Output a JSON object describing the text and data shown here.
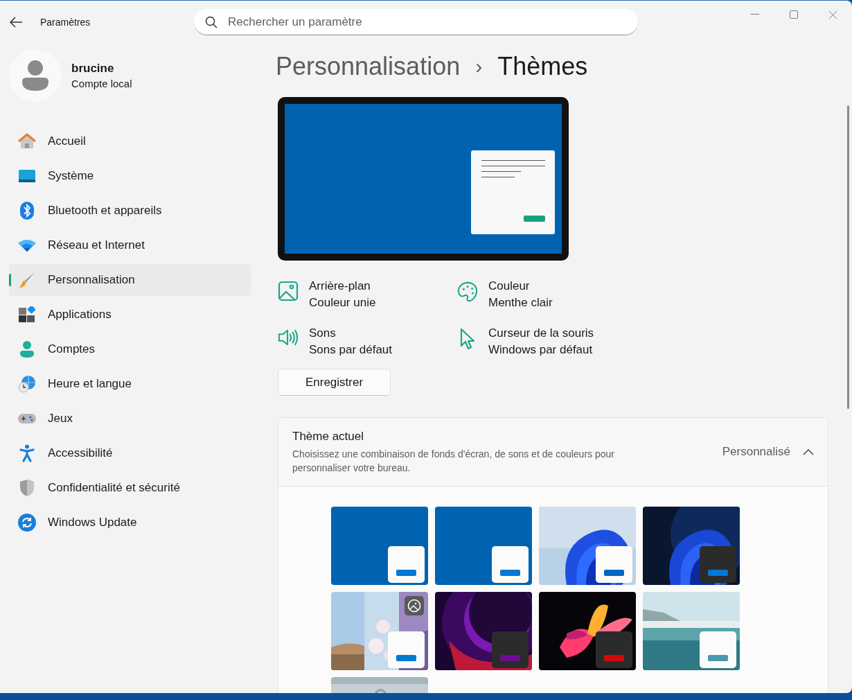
{
  "window": {
    "title": "Paramètres"
  },
  "search": {
    "placeholder": "Rechercher un paramètre"
  },
  "account": {
    "name": "brucine",
    "type": "Compte local"
  },
  "sidebar": {
    "items": [
      {
        "label": "Accueil",
        "selected": false
      },
      {
        "label": "Système",
        "selected": false
      },
      {
        "label": "Bluetooth et appareils",
        "selected": false
      },
      {
        "label": "Réseau et Internet",
        "selected": false
      },
      {
        "label": "Personnalisation",
        "selected": true
      },
      {
        "label": "Applications",
        "selected": false
      },
      {
        "label": "Comptes",
        "selected": false
      },
      {
        "label": "Heure et langue",
        "selected": false
      },
      {
        "label": "Jeux",
        "selected": false
      },
      {
        "label": "Accessibilité",
        "selected": false
      },
      {
        "label": "Confidentialité et sécurité",
        "selected": false
      },
      {
        "label": "Windows Update",
        "selected": false
      }
    ]
  },
  "breadcrumb": {
    "parent": "Personnalisation",
    "separator": "›",
    "current": "Thèmes"
  },
  "settings": [
    {
      "title": "Arrière-plan",
      "value": "Couleur unie"
    },
    {
      "title": "Couleur",
      "value": "Menthe clair"
    },
    {
      "title": "Sons",
      "value": "Sons par défaut"
    },
    {
      "title": "Curseur de la souris",
      "value": "Windows par défaut"
    }
  ],
  "save_button": {
    "label": "Enregistrer"
  },
  "current_theme": {
    "title": "Thème actuel",
    "description": "Choisissez une combinaison de fonds d'écran, de sons et de couleurs pour personnaliser votre bureau.",
    "value": "Personnalisé",
    "expanded": true,
    "themes": [
      {
        "kind": "solid",
        "dark": false,
        "color": "#0078d4",
        "slideshow": false
      },
      {
        "kind": "solid",
        "dark": false,
        "color": "#0078d4",
        "slideshow": false
      },
      {
        "kind": "picture",
        "dark": false,
        "color": "#0067c0",
        "slideshow": false
      },
      {
        "kind": "picture",
        "dark": true,
        "color": "#0078d4",
        "slideshow": false
      },
      {
        "kind": "picture",
        "dark": false,
        "color": "#0078d4",
        "slideshow": true
      },
      {
        "kind": "picture",
        "dark": true,
        "color": "#6b0d8f",
        "slideshow": false
      },
      {
        "kind": "picture",
        "dark": true,
        "color": "#d10a0a",
        "slideshow": false
      },
      {
        "kind": "picture",
        "dark": false,
        "color": "#4a9aab",
        "slideshow": false
      },
      {
        "kind": "picture"
      }
    ]
  }
}
